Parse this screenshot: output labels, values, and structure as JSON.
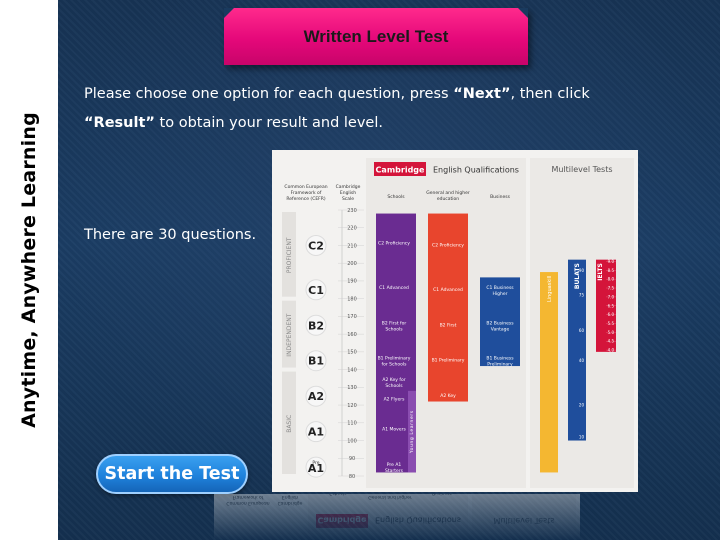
{
  "sidebar": {
    "tagline": "Anytime, Anywhere Learning"
  },
  "header": {
    "title": "Written Level Test"
  },
  "instructions": {
    "line1_pre": "Please choose one option for each question, press ",
    "line1_next": "“Next”",
    "line1_post": ", then click",
    "line2_result": "“Result”",
    "line2_post": " to obtain your result and level.",
    "question_count": "There are 30 questions."
  },
  "actions": {
    "start_label": "Start the Test"
  },
  "colors": {
    "banner": "#e5087a",
    "background": "#1b3d64",
    "button": "#1f82dc",
    "schools": "#6a2c91",
    "general": "#e8452d",
    "business": "#1f4e9c",
    "linguaskill": "#f4b731",
    "bulats": "#1f4e9c",
    "ielts": "#d4143a"
  },
  "chart_data": {
    "type": "table",
    "cambridge_brand": "Cambridge",
    "cambridge_title": "English Qualifications",
    "multilevel_title": "Multilevel Tests",
    "cefr_header": "Common European Framework of Reference (CEFR)",
    "scale_header": "Cambridge English Scale",
    "columns": [
      "Schools",
      "General and higher education",
      "Business"
    ],
    "bands": [
      "PROFICIENT",
      "INDEPENDENT",
      "BASIC"
    ],
    "levels": [
      "C2",
      "C1",
      "B2",
      "B1",
      "A2",
      "A1",
      "Pre A1"
    ],
    "scale_ticks": [
      230,
      220,
      210,
      200,
      190,
      180,
      170,
      160,
      150,
      140,
      130,
      120,
      110,
      100,
      90,
      80
    ],
    "schools": [
      "C2 Proficiency",
      "C1 Advanced",
      "B2 First for Schools",
      "B1 Preliminary for Schools",
      "A2 Key for Schools",
      "A2 Flyers",
      "A1 Movers",
      "Pre A1 Starters"
    ],
    "young_learners_label": "Young Learners",
    "general": [
      "C2 Proficiency",
      "C1 Advanced",
      "B2 First",
      "B1 Preliminary",
      "A2 Key"
    ],
    "business": [
      "C1 Business Higher",
      "B2 Business Vantage",
      "B1 Business Preliminary"
    ],
    "linguaskill_label": "Linguaskill",
    "bulats_label": "BULATS",
    "bulats_ticks": [
      90,
      75,
      60,
      40,
      20,
      10
    ],
    "ielts_label": "IELTS",
    "ielts_ticks": [
      9.0,
      8.5,
      8.0,
      7.5,
      7.0,
      6.5,
      6.0,
      5.5,
      5.0,
      4.5,
      4.0
    ]
  }
}
